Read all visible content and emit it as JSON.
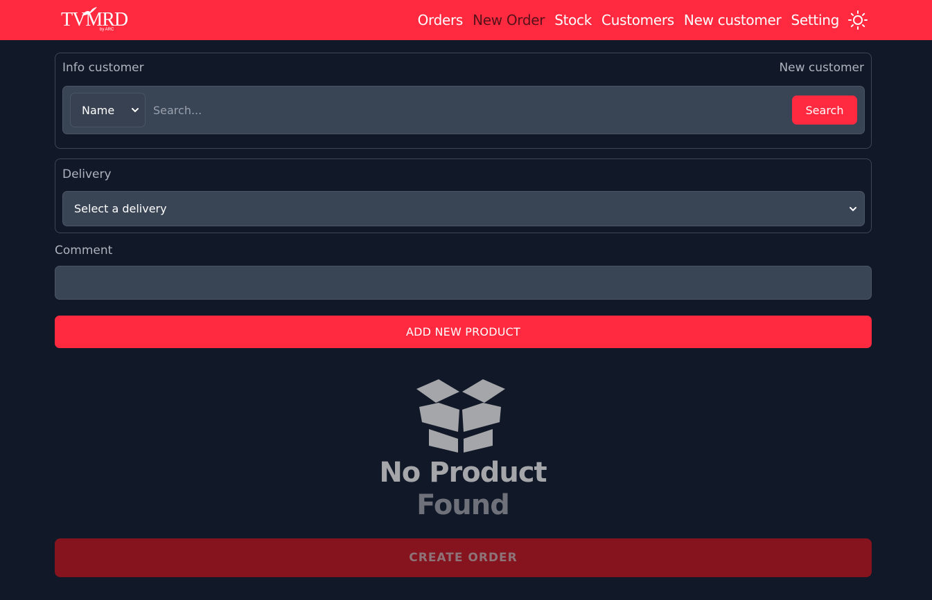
{
  "brand": {
    "logo_text": "TVMRD",
    "logo_sub": "by ARC"
  },
  "nav": {
    "items": [
      "Orders",
      "New Order",
      "Stock",
      "Customers",
      "New customer",
      "Setting"
    ],
    "active": "New Order"
  },
  "info_customer": {
    "title": "Info customer",
    "new_customer_link": "New customer",
    "filter_selected": "Name",
    "search_placeholder": "Search...",
    "search_button": "Search"
  },
  "delivery": {
    "title": "Delivery",
    "selected": "Select a delivery"
  },
  "comment": {
    "label": "Comment",
    "value": ""
  },
  "add_product_button": "ADD NEW PRODUCT",
  "empty_state": {
    "line1": "No Product",
    "line2": "Found"
  },
  "create_order_button": "CREATE ORDER",
  "icons": {
    "theme_toggle": "sun-icon",
    "dropdown": "chevron-down-icon",
    "empty": "open-box-icon"
  },
  "colors": {
    "brand_red": "#ff2a3f",
    "background": "#111827",
    "field": "#394455",
    "disabled_red": "#85141f"
  }
}
